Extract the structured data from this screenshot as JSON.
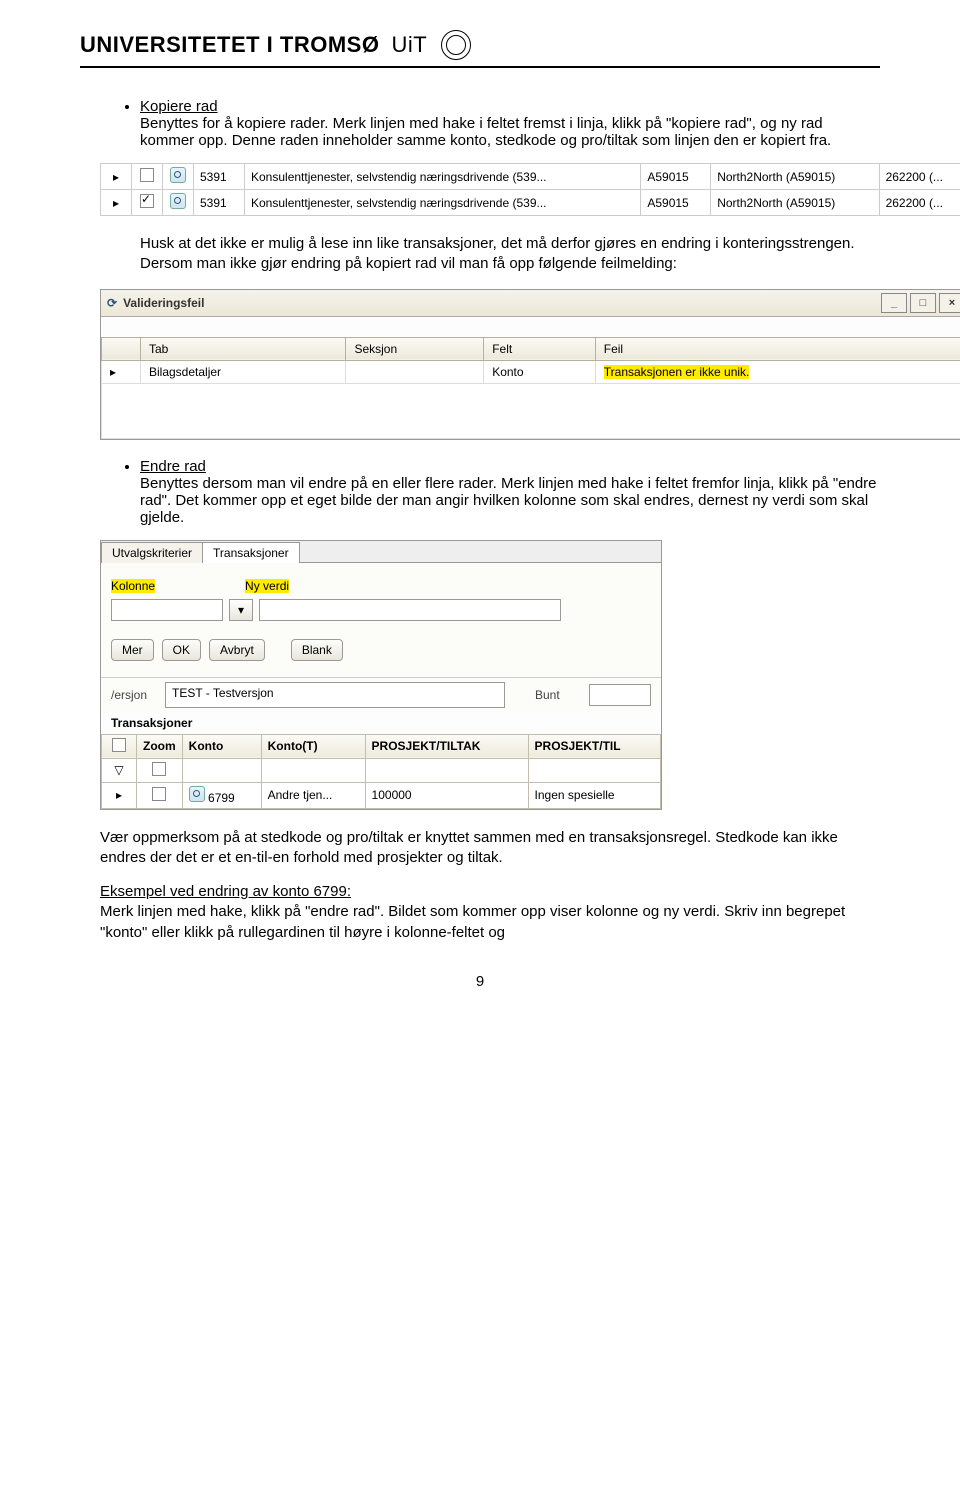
{
  "header": {
    "university": "UNIVERSITETET I TROMSØ",
    "uit": "UiT"
  },
  "s1": {
    "title": "Kopiere rad",
    "body": "Benyttes for å kopiere rader. Merk linjen med hake i feltet fremst i linja, klikk på \"kopiere rad\", og ny rad kommer opp. Denne raden inneholder samme konto, stedkode og pro/tiltak som linjen den er kopiert fra."
  },
  "ss1": {
    "rows": [
      {
        "chk": false,
        "konto": "5391",
        "tekst": "Konsulenttjenester, selvstendig næringsdrivende (539...",
        "kode": "A59015",
        "prosjekt": "North2North (A59015)",
        "belop": "262200 (..."
      },
      {
        "chk": true,
        "konto": "5391",
        "tekst": "Konsulenttjenester, selvstendig næringsdrivende (539...",
        "kode": "A59015",
        "prosjekt": "North2North (A59015)",
        "belop": "262200 (..."
      }
    ]
  },
  "p2": "Husk at det ikke er mulig å lese inn like transaksjoner, det må derfor gjøres en endring i konteringsstrengen. Dersom man ikke gjør endring på kopiert rad vil man få opp følgende feilmelding:",
  "ss2": {
    "title": "Valideringsfeil",
    "headers": [
      "Tab",
      "Seksjon",
      "Felt",
      "Feil"
    ],
    "row": {
      "tab": "Bilagsdetaljer",
      "seksjon": "",
      "felt": "Konto",
      "feil": "Transaksjonen er ikke unik."
    }
  },
  "s3": {
    "title": "Endre rad",
    "body": "Benyttes dersom man vil endre på en eller flere rader. Merk linjen med hake i feltet fremfor linja, klikk på \"endre rad\". Det kommer opp et eget bilde der man angir hvilken kolonne som skal endres, dernest ny verdi som skal gjelde."
  },
  "ss3": {
    "tab1": "Utvalgskriterier",
    "tab2": "Transaksjoner",
    "label_kolonne": "Kolonne",
    "label_nyverdi": "Ny verdi",
    "btn_mer": "Mer",
    "btn_ok": "OK",
    "btn_avbryt": "Avbryt",
    "btn_blank": "Blank",
    "versjon_label": "/ersjon",
    "versjon_val": "TEST - Testversjon",
    "bunt_label": "Bunt",
    "trans_header": "Transaksjoner",
    "cols": [
      "",
      "Zoom",
      "Konto",
      "Konto(T)",
      "PROSJEKT/TILTAK",
      "PROSJEKT/TIL"
    ],
    "rowdata": {
      "konto": "6799",
      "kontot": "Andre tjen...",
      "prosjekt": "100000",
      "prosjt": "Ingen spesielle"
    }
  },
  "p4": "Vær oppmerksom på at stedkode og pro/tiltak er knyttet sammen med en transaksjonsregel. Stedkode kan ikke endres der det er et en-til-en forhold med prosjekter og tiltak.",
  "p5a": "Eksempel ved endring av konto 6799:",
  "p5b": "Merk linjen med hake, klikk på \"endre rad\". Bildet som kommer opp viser kolonne og ny verdi. Skriv inn begrepet \"konto\" eller klikk på rullegardinen til høyre i kolonne-feltet og",
  "page_number": "9"
}
